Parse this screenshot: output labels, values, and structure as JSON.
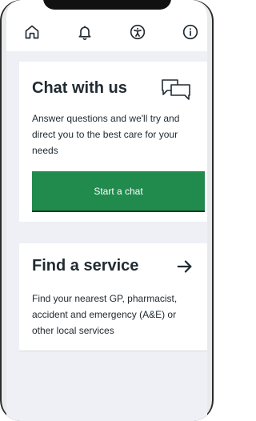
{
  "nav": {
    "items": [
      {
        "icon": "home-icon"
      },
      {
        "icon": "bell-icon"
      },
      {
        "icon": "accessibility-icon"
      },
      {
        "icon": "info-icon"
      }
    ]
  },
  "chat_card": {
    "title": "Chat with us",
    "description": "Answer questions and we'll try and direct you to the best care for your needs",
    "button_label": "Start a chat",
    "icon": "chat-bubbles-icon"
  },
  "find_card": {
    "title": "Find a service",
    "description": "Find your nearest GP, pharmacist, accident and emergency (A&E) or other local services",
    "icon": "arrow-right-icon"
  },
  "colors": {
    "primary_button": "#218a4d",
    "text": "#212b32",
    "page_background": "#eef0f5",
    "card_background": "#ffffff"
  }
}
